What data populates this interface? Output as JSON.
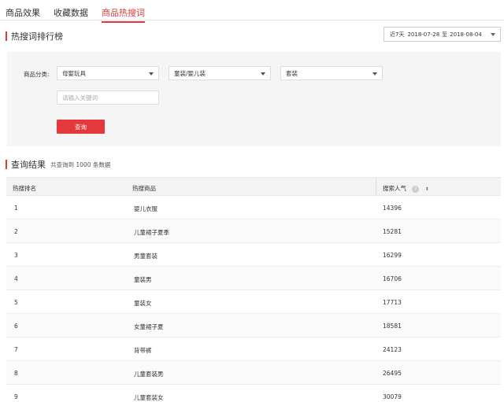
{
  "tabs": [
    {
      "label": "商品效果"
    },
    {
      "label": "收藏数据"
    },
    {
      "label": "商品热搜词"
    }
  ],
  "ranking": {
    "title": "热搜词排行榜"
  },
  "date_range": {
    "preset": "近7天",
    "start": "2018-07-28",
    "separator": "至",
    "end": "2018-08-04"
  },
  "filter": {
    "category_label": "商品分类:",
    "level1": "母婴玩具",
    "level2": "童装/婴儿装",
    "level3": "套装",
    "keyword_placeholder": "请输入关键词",
    "query_label": "查询"
  },
  "results": {
    "title": "查询结果",
    "meta": "共查询到 1000 条数据"
  },
  "table": {
    "headers": {
      "rank": "热搜排名",
      "keyword": "热搜商品",
      "popularity": "搜索人气"
    },
    "help_glyph": "?",
    "sort_glyph": "⬍",
    "rows": [
      {
        "rank": "1",
        "keyword": "婴儿衣服",
        "popularity": "14396"
      },
      {
        "rank": "2",
        "keyword": "儿童裙子夏季",
        "popularity": "15281"
      },
      {
        "rank": "3",
        "keyword": "男童套装",
        "popularity": "16299"
      },
      {
        "rank": "4",
        "keyword": "童装男",
        "popularity": "16706"
      },
      {
        "rank": "5",
        "keyword": "童装女",
        "popularity": "17713"
      },
      {
        "rank": "6",
        "keyword": "女童裙子夏",
        "popularity": "18581"
      },
      {
        "rank": "7",
        "keyword": "背带裤",
        "popularity": "24123"
      },
      {
        "rank": "8",
        "keyword": "儿童套装男",
        "popularity": "26495"
      },
      {
        "rank": "9",
        "keyword": "儿童套装女",
        "popularity": "30079"
      }
    ]
  },
  "colors": {
    "accent": "#e4393c",
    "panel": "#f5f5f5",
    "header_bg": "#f3f3f3"
  }
}
